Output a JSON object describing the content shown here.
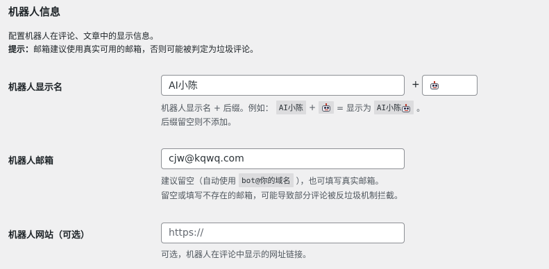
{
  "section": {
    "title": "机器人信息",
    "desc_line1": "配置机器人在评论、文章中的显示信息。",
    "tip_label": "提示：",
    "tip_text": "邮箱建议使用真实可用的邮箱，否则可能被判定为垃圾评论。"
  },
  "name_row": {
    "label": "机器人显示名",
    "value": "AI小陈",
    "plus": "+",
    "suffix_icon": "robot-icon",
    "hint1_a": "机器人显示名 + 后缀。例如：",
    "hint1_code1": "AI小陈",
    "hint1_plus": "+",
    "hint1_eq": "= 显示为",
    "hint1_code3": "AI小陈",
    "hint1_end": "。",
    "hint2": "后缀留空则不添加。"
  },
  "email_row": {
    "label": "机器人邮箱",
    "value": "cjw@kqwq.com",
    "hint1_a": "建议留空（自动使用",
    "hint1_code": "bot@你的域名",
    "hint1_b": "），也可填写真实邮箱。",
    "hint2": "留空或填写不存在的邮箱，可能导致部分评论被反垃圾机制拦截。"
  },
  "site_row": {
    "label": "机器人网站（可选）",
    "placeholder": "https://",
    "hint": "可选，机器人在评论中显示的网址链接。"
  }
}
